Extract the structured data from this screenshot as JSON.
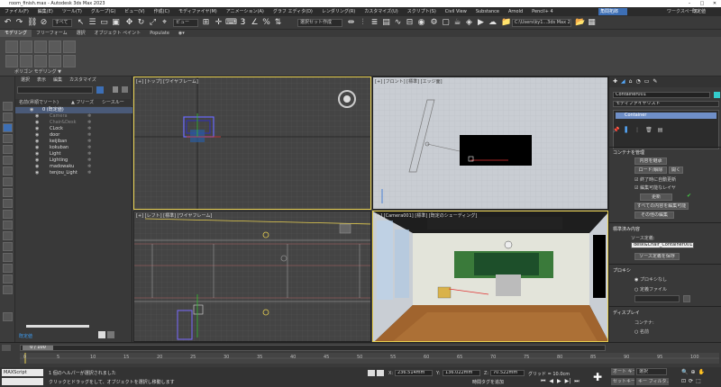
{
  "window": {
    "title": "room_finish.max - Autodesk 3ds Max 2023"
  },
  "menu": [
    "ファイル(F)",
    "編集(E)",
    "ツール(T)",
    "グループ(G)",
    "ビュー(V)",
    "作成(C)",
    "モディファイヤ(M)",
    "アニメーション(A)",
    "グラフ エディタ(D)",
    "レンダリング(R)",
    "カスタマイズ(U)",
    "スクリプト(S)",
    "Civil View",
    "Substance",
    "Arnold",
    "Pencil+ 4"
  ],
  "menu_right": {
    "signin": "角間拓郎",
    "workspaces": "ワークスペース:",
    "workspace_value": "既定値"
  },
  "toolbar": {
    "filter": "すべて",
    "ref_coord": "ビュー",
    "selection_set": "選択セット作成",
    "project_path": "C:\\Users\\ky1...3ds Max 2023"
  },
  "ribbon_tabs": [
    {
      "label": "モデリング",
      "active": true
    },
    {
      "label": "フリーフォーム",
      "active": false
    },
    {
      "label": "選択",
      "active": false
    },
    {
      "label": "オブジェクト ペイント",
      "active": false
    },
    {
      "label": "Populate",
      "active": false
    }
  ],
  "ribbon": {
    "polygon_modeling": "ポリゴン モデリング ▼"
  },
  "scene_explorer": {
    "tabs": [
      "選択",
      "表示",
      "編集",
      "カスタマイズ"
    ],
    "columns": {
      "name": "名前(昇順でソート)",
      "freeze": "▲ フリーズ",
      "see_through": "シースルー"
    },
    "rows": [
      {
        "name": "0 (既定値)",
        "layer": true
      },
      {
        "name": "Camera"
      },
      {
        "name": "Chair&Desk"
      },
      {
        "name": "CLock"
      },
      {
        "name": "door"
      },
      {
        "name": "keijiban"
      },
      {
        "name": "kokuban"
      },
      {
        "name": "Light"
      },
      {
        "name": "Lighting"
      },
      {
        "name": "madowaku"
      },
      {
        "name": "tenjou_Light"
      }
    ],
    "footer_label": "既定値"
  },
  "viewports": {
    "top": "[+] [トップ] [ワイヤフレーム]",
    "front": "[+] [フロント] [標準] [エッジ面]",
    "left": "[+] [レフト] [標準] [ワイヤフレーム]",
    "perspective": "[+] [Camera001] [標準] [既定のシェーディング]"
  },
  "command_panel": {
    "object_name": "Container001",
    "modifier_list": "モディファイヤリスト",
    "stack_item": "Container",
    "rollout_manage": "コンテナを管理",
    "btn_inherit": "内容を継承",
    "btn_load": "ロード/解除",
    "btn_open": "開く",
    "chk_auto_update": "終了時に自動更新",
    "chk_display_layer": "編集可能なレイヤ",
    "btn_update": "更新",
    "btn_edit_all": "すべての内容を編集可能",
    "btn_other": "その他の編集",
    "rollout_local": "標準済み内容",
    "local_def_label": "ソース定義:",
    "local_def_value": "desk&Chair_Container001.max",
    "btn_save_source": "ソース定義を保存",
    "rollout_proxy": "プロキシ",
    "radio_no_proxy": "プロキシなし",
    "radio_file": "定義ファイル",
    "rollout_display": "ディスプレイ",
    "display_label": "コンテナ:",
    "radio_name": "名前"
  },
  "timeline": {
    "frame": "0 / 100",
    "ticks": [
      "0",
      "5",
      "10",
      "15",
      "20",
      "25",
      "30",
      "35",
      "40",
      "45",
      "50",
      "55",
      "60",
      "65",
      "70",
      "75",
      "80",
      "85",
      "90",
      "95",
      "100"
    ]
  },
  "status": {
    "script_label": "MAXScript",
    "selected": "1 個のヘルパーが選択されました",
    "hint": "クリックとドラッグをして、オブジェクトを選択し移動します",
    "x_label": "X:",
    "x": "236.514mm",
    "y_label": "Y:",
    "y": "136.022mm",
    "z_label": "Z:",
    "z": "70.522mm",
    "grid": "グリッド = 10.0cm",
    "add_time_tag": "時間タグを追加",
    "autokey": "オート キー",
    "setkey": "セットキー",
    "selection": "選択",
    "key_filters": "キー フィルタ..."
  }
}
